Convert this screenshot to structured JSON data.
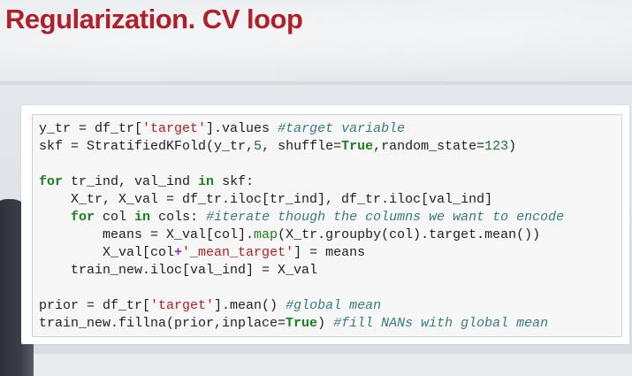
{
  "slide": {
    "title": "Regularization. CV loop"
  },
  "code": {
    "l1": {
      "a": "y_tr = df_tr[",
      "b": "'target'",
      "c": "].values ",
      "d": "#target variable"
    },
    "l2": {
      "a": "skf = StratifiedKFold(y_tr,",
      "b": "5",
      "c": ", shuffle=",
      "d": "True",
      "e": ",random_state=",
      "f": "123",
      "g": ")"
    },
    "l4": {
      "a": "for",
      "b": " tr_ind, val_ind ",
      "c": "in",
      "d": " skf:"
    },
    "l5": {
      "a": "    X_tr, X_val = df_tr.iloc[tr_ind], df_tr.iloc[val_ind]"
    },
    "l6": {
      "a": "    ",
      "b": "for",
      "c": " col ",
      "d": "in",
      "e": " cols: ",
      "f": "#iterate though the columns we want to encode"
    },
    "l7": {
      "a": "        means = X_val[col].",
      "b": "map",
      "c": "(X_tr.groupby(col).target.mean())"
    },
    "l8": {
      "a": "        X_val[col",
      "b": "+",
      "c": "'_mean_target'",
      "d": "] = means"
    },
    "l9": {
      "a": "    train_new.iloc[val_ind] = X_val"
    },
    "l11": {
      "a": "prior = df_tr[",
      "b": "'target'",
      "c": "].mean() ",
      "d": "#global mean"
    },
    "l12": {
      "a": "train_new.fillna(prior,inplace=",
      "b": "True",
      "c": ") ",
      "d": "#fill NANs with global mean"
    }
  }
}
